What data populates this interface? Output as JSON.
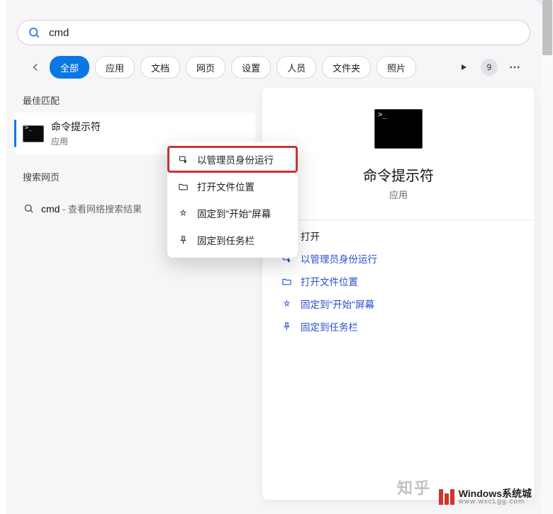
{
  "search": {
    "value": "cmd",
    "placeholder": ""
  },
  "filters": {
    "items": [
      {
        "label": "全部",
        "active": true
      },
      {
        "label": "应用",
        "active": false
      },
      {
        "label": "文档",
        "active": false
      },
      {
        "label": "网页",
        "active": false
      },
      {
        "label": "设置",
        "active": false
      },
      {
        "label": "人员",
        "active": false
      },
      {
        "label": "文件夹",
        "active": false
      },
      {
        "label": "照片",
        "active": false
      }
    ],
    "badge_count": "9"
  },
  "left": {
    "best_match_heading": "最佳匹配",
    "best_match": {
      "title": "命令提示符",
      "subtitle": "应用"
    },
    "web_heading": "搜索网页",
    "web_item": {
      "query": "cmd",
      "hint": " - 查看网络搜索结果"
    }
  },
  "context_menu": {
    "items": [
      {
        "icon": "admin-shield-icon",
        "label": "以管理员身份运行",
        "highlighted": true
      },
      {
        "icon": "folder-open-icon",
        "label": "打开文件位置",
        "highlighted": false
      },
      {
        "icon": "pin-start-icon",
        "label": "固定到\"开始\"屏幕",
        "highlighted": false
      },
      {
        "icon": "pin-taskbar-icon",
        "label": "固定到任务栏",
        "highlighted": false
      }
    ]
  },
  "detail": {
    "title": "命令提示符",
    "subtitle": "应用",
    "actions": [
      {
        "icon": "",
        "label": "打开",
        "plain": true
      },
      {
        "icon": "admin-shield-icon",
        "label": "以管理员身份运行",
        "plain": false
      },
      {
        "icon": "folder-open-icon",
        "label": "打开文件位置",
        "plain": false
      },
      {
        "icon": "pin-start-icon",
        "label": "固定到\"开始\"屏幕",
        "plain": false
      },
      {
        "icon": "pin-taskbar-icon",
        "label": "固定到任务栏",
        "plain": false
      }
    ]
  },
  "watermark": {
    "zhihu": "知乎",
    "brand_main": "Windows系统城",
    "brand_sub": "www.wxcLgg.com"
  },
  "icons": {
    "search": "search-icon",
    "back": "back-icon",
    "play": "play-icon",
    "more": "more-icon"
  },
  "colors": {
    "accent": "#0a78e3",
    "highlight": "#c63438"
  }
}
